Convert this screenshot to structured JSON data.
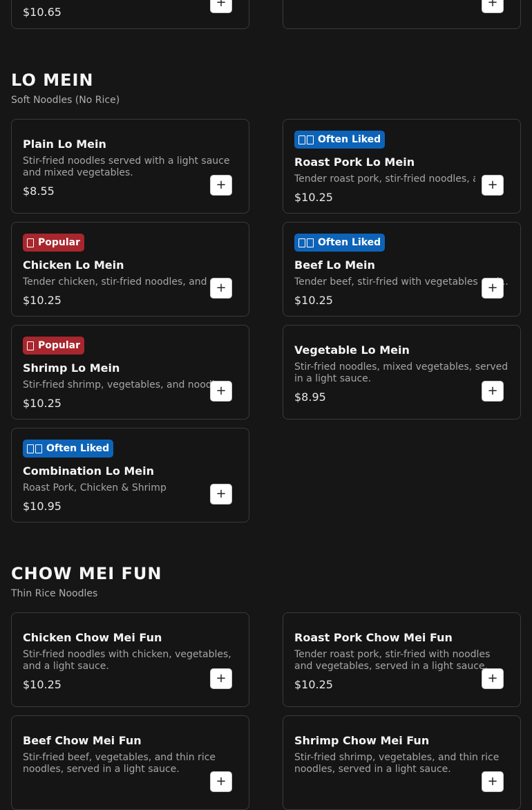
{
  "top_row": {
    "left_price": "$10.65",
    "add_label": "+"
  },
  "sections": [
    {
      "title": "LO MEIN",
      "subtitle": "Soft Noodles (No Rice)",
      "items": [
        {
          "name": "Plain Lo Mein",
          "description": "Stir-fried noodles served with a light sauce and mixed vegetables.",
          "price": "$8.55"
        },
        {
          "badge": "Often Liked",
          "name": "Roast Pork Lo Mein",
          "description": "Tender roast pork, stir-fried noodles, and",
          "price": "$10.25"
        },
        {
          "badge": "Popular",
          "name": "Chicken Lo Mein",
          "description": "Tender chicken, stir-fried noodles, and",
          "price": "$10.25"
        },
        {
          "badge": "Often Liked",
          "name": "Beef Lo Mein",
          "description": "Tender beef, stir-fried with vegetables and...",
          "price": "$10.25"
        },
        {
          "badge": "Popular",
          "name": "Shrimp Lo Mein",
          "description": "Stir-fried shrimp, vegetables, and noodles.",
          "price": "$10.25"
        },
        {
          "name": "Vegetable Lo Mein",
          "description": "Stir-fried noodles, mixed vegetables, served in a light sauce.",
          "price": "$8.95"
        },
        {
          "badge": "Often Liked",
          "name": "Combination Lo Mein",
          "description": "Roast Pork, Chicken & Shrimp",
          "price": "$10.95"
        }
      ]
    },
    {
      "title": "CHOW MEI FUN",
      "subtitle": "Thin Rice Noodles",
      "items": [
        {
          "name": "Chicken Chow Mei Fun",
          "description": "Stir-fried noodles with chicken, vegetables, and a light sauce.",
          "price": "$10.25"
        },
        {
          "name": "Roast Pork Chow Mei Fun",
          "description": "Tender roast pork, stir-fried with noodles and vegetables, served in a light sauce.",
          "price": "$10.25"
        },
        {
          "name": "Beef Chow Mei Fun",
          "description": "Stir-fried beef, vegetables, and thin rice noodles, served in a light sauce.",
          "price": ""
        },
        {
          "name": "Shrimp Chow Mei Fun",
          "description": "Stir-fried shrimp, vegetables, and thin rice noodles, served in a light sauce.",
          "price": ""
        }
      ]
    }
  ],
  "icons": {
    "popular": "fire-icon",
    "often_liked": "thumbs-up-icon"
  },
  "colors": {
    "popular_badge": "#a8262d",
    "often_liked_badge": "#0d63b8",
    "background": "#161616"
  }
}
